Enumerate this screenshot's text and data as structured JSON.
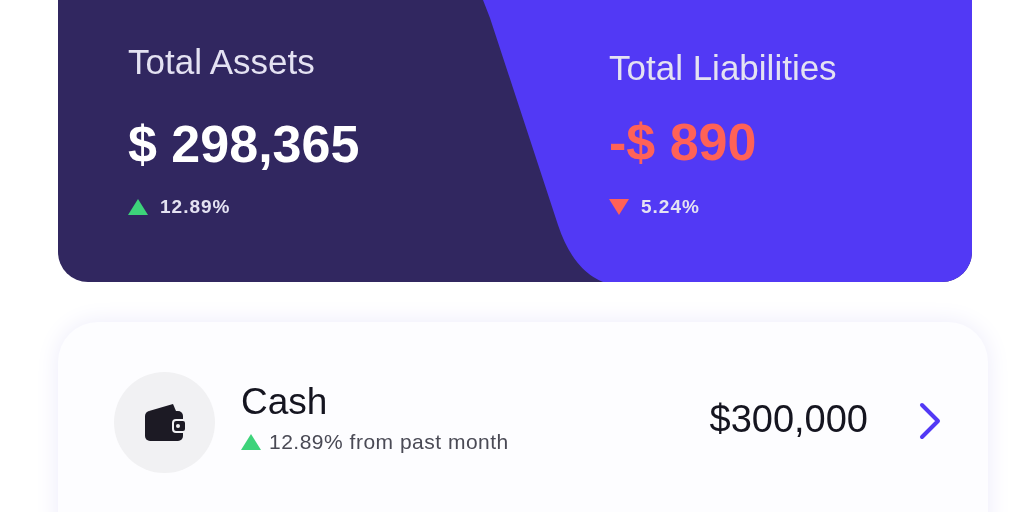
{
  "summary": [
    {
      "title": "Total Assets",
      "amount": "$ 298,365",
      "negative": false,
      "rising": true,
      "change": "12.89%"
    },
    {
      "title": "Total Liabilities",
      "amount": "-$ 890",
      "negative": true,
      "rising": false,
      "change": "5.24%"
    }
  ],
  "accounts": [
    {
      "name": "Cash",
      "rising": true,
      "change": "12.89% from past month",
      "amount": "$300,000"
    }
  ]
}
